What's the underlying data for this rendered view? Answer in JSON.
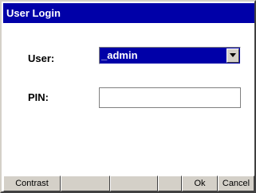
{
  "window": {
    "title": "User Login"
  },
  "form": {
    "user_label": "User:",
    "user_value": "_admin",
    "pin_label": "PIN:",
    "pin_value": ""
  },
  "buttons": {
    "contrast": "Contrast",
    "blank1": "",
    "blank2": "",
    "blank3": "",
    "ok": "Ok",
    "cancel": "Cancel"
  },
  "colors": {
    "titlebar": "#0000a8",
    "face": "#d4d0c8",
    "selection": "#0000a8"
  },
  "icons": {
    "dropdown": "chevron-down-icon"
  }
}
